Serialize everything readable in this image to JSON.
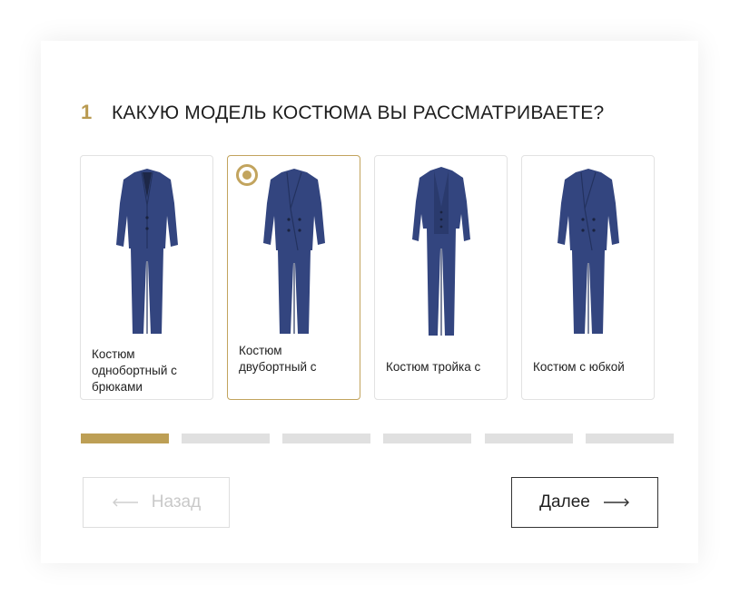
{
  "question": {
    "number": "1",
    "text": "КАКУЮ МОДЕЛЬ КОСТЮМА ВЫ РАССМАТРИВАЕТЕ?"
  },
  "options": [
    {
      "label": "Костюм однобортный с брюками",
      "selected": false,
      "image": "single-breasted-suit-icon"
    },
    {
      "label": "Костюм двубортный с",
      "selected": true,
      "image": "double-breasted-suit-icon"
    },
    {
      "label": "Костюм тройка с",
      "selected": false,
      "image": "three-piece-suit-icon"
    },
    {
      "label": "Костюм с юбкой",
      "selected": false,
      "image": "skirt-suit-icon"
    }
  ],
  "progress": {
    "current_step": 1,
    "total_steps": 6
  },
  "nav": {
    "back_label": "Назад",
    "next_label": "Далее"
  },
  "colors": {
    "accent": "#bd9f55",
    "suit": "#33457f",
    "progress_inactive": "#e0e0e0"
  }
}
